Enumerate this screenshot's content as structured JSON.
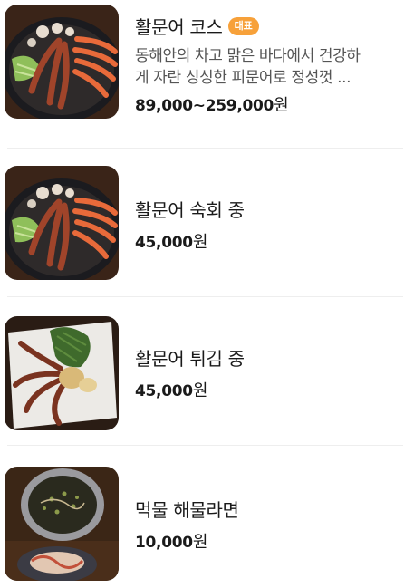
{
  "menu": {
    "items": [
      {
        "name": "활문어 코스",
        "badge": "대표",
        "desc_line1": "동해안의 차고 맑은 바다에서 건강하",
        "desc_line2": "게 자란 싱싱한 피문어로 정성껏 ...",
        "price": "89,000~259,000",
        "unit": "원",
        "image": "octopus-shrimp-hotpot"
      },
      {
        "name": "활문어 숙회 중",
        "price": "45,000",
        "unit": "원",
        "image": "octopus-shrimp-hotpot"
      },
      {
        "name": "활문어 튀김 중",
        "price": "45,000",
        "unit": "원",
        "image": "fried-octopus-with-seaweed"
      },
      {
        "name": "먹물 해물라면",
        "price": "10,000",
        "unit": "원",
        "image": "squid-ink-ramen"
      }
    ]
  }
}
